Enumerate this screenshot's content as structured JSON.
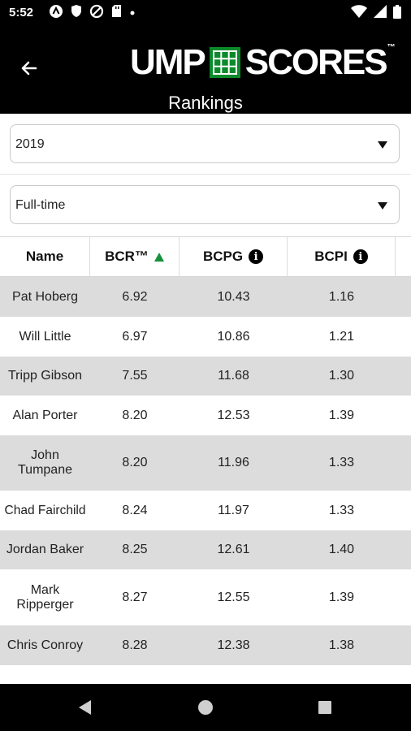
{
  "status": {
    "time": "5:52"
  },
  "header": {
    "back_icon": "arrow-left-icon",
    "logo_left": "UMP",
    "logo_right": "SCORES",
    "logo_tm": "™",
    "subtitle": "Rankings"
  },
  "filters": {
    "season": {
      "value": "2019"
    },
    "status": {
      "value": "Full-time"
    }
  },
  "table": {
    "columns": {
      "name": "Name",
      "bcr": "BCR™",
      "bcpg": "BCPG",
      "bcpi": "BCPI"
    },
    "sort": {
      "column": "bcr",
      "direction": "ascending",
      "color": "#14913a"
    },
    "rows": [
      {
        "name": "Pat Hoberg",
        "bcr": "6.92",
        "bcpg": "10.43",
        "bcpi": "1.16"
      },
      {
        "name": "Will Little",
        "bcr": "6.97",
        "bcpg": "10.86",
        "bcpi": "1.21"
      },
      {
        "name": "Tripp Gibson",
        "bcr": "7.55",
        "bcpg": "11.68",
        "bcpi": "1.30"
      },
      {
        "name": "Alan Porter",
        "bcr": "8.20",
        "bcpg": "12.53",
        "bcpi": "1.39"
      },
      {
        "name": "John Tumpane",
        "bcr": "8.20",
        "bcpg": "11.96",
        "bcpi": "1.33"
      },
      {
        "name": "Chad Fairchild",
        "bcr": "8.24",
        "bcpg": "11.97",
        "bcpi": "1.33"
      },
      {
        "name": "Jordan Baker",
        "bcr": "8.25",
        "bcpg": "12.61",
        "bcpi": "1.40"
      },
      {
        "name": "Mark Ripperger",
        "bcr": "8.27",
        "bcpg": "12.55",
        "bcpi": "1.39"
      },
      {
        "name": "Chris Conroy",
        "bcr": "8.28",
        "bcpg": "12.38",
        "bcpi": "1.38"
      }
    ]
  },
  "colors": {
    "brand_green": "#0a8a2a",
    "header_bg": "#000000",
    "alt_row": "#dcdcdc"
  }
}
